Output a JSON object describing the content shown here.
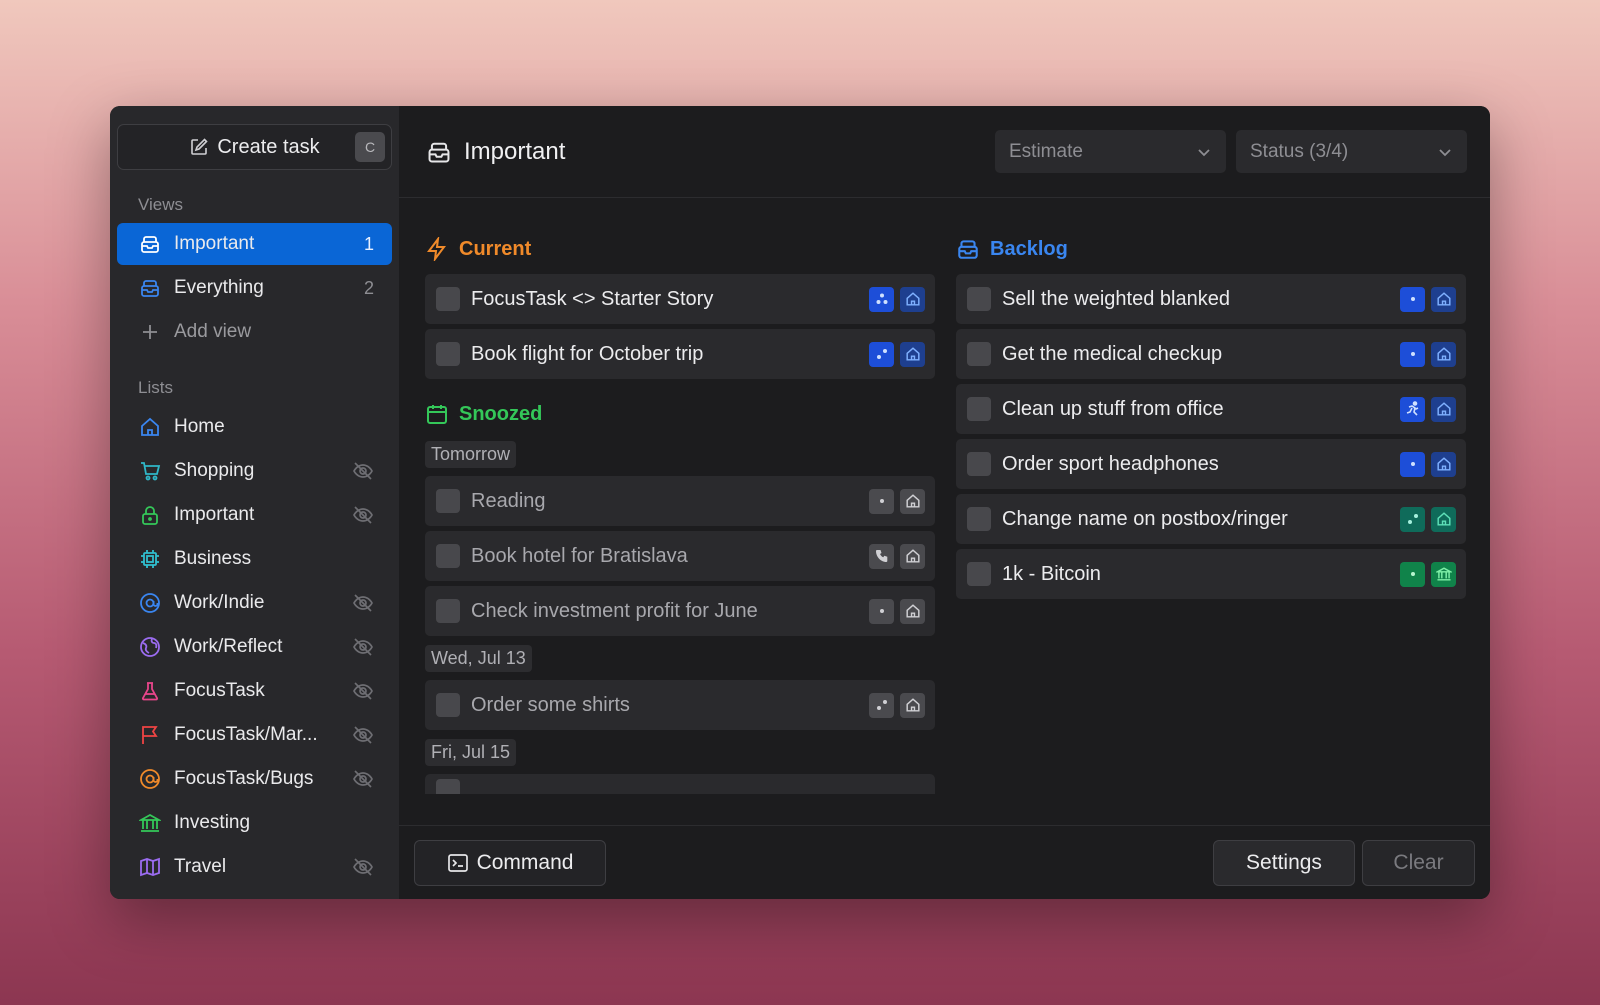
{
  "sidebar": {
    "create_label": "Create task",
    "create_shortcut": "C",
    "views_label": "Views",
    "views": [
      {
        "label": "Important",
        "count": "1",
        "active": true
      },
      {
        "label": "Everything",
        "count": "2"
      },
      {
        "label": "Add view"
      }
    ],
    "lists_label": "Lists",
    "lists": [
      {
        "label": "Home",
        "icon": "home-icon",
        "color": "#3a86f0",
        "hidden": false
      },
      {
        "label": "Shopping",
        "icon": "cart-icon",
        "color": "#2fb7c8",
        "hidden": true
      },
      {
        "label": "Important",
        "icon": "lock-icon",
        "color": "#34c759",
        "hidden": true
      },
      {
        "label": "Business",
        "icon": "chip-icon",
        "color": "#30c0d0",
        "hidden": false
      },
      {
        "label": "Work/Indie",
        "icon": "at-icon",
        "color": "#3a86f0",
        "hidden": true
      },
      {
        "label": "Work/Reflect",
        "icon": "globe-icon",
        "color": "#9b6cf0",
        "hidden": true
      },
      {
        "label": "FocusTask",
        "icon": "flask-icon",
        "color": "#e8458b",
        "hidden": true
      },
      {
        "label": "FocusTask/Mar...",
        "icon": "flag-icon",
        "color": "#ef4444",
        "hidden": true
      },
      {
        "label": "FocusTask/Bugs",
        "icon": "at-icon",
        "color": "#f08a2a",
        "hidden": true
      },
      {
        "label": "Investing",
        "icon": "bank-icon",
        "color": "#34c759",
        "hidden": false
      },
      {
        "label": "Travel",
        "icon": "map-icon",
        "color": "#9b6cf0",
        "hidden": true
      }
    ]
  },
  "header": {
    "title": "Important",
    "estimate_label": "Estimate",
    "status_label": "Status (3/4)"
  },
  "current": {
    "title": "Current",
    "tasks": [
      {
        "label": "FocusTask <> Starter Story"
      },
      {
        "label": "Book flight for October trip"
      }
    ]
  },
  "snoozed": {
    "title": "Snoozed",
    "groups": [
      {
        "date": "Tomorrow",
        "tasks": [
          {
            "label": "Reading"
          },
          {
            "label": "Book hotel for Bratislava"
          },
          {
            "label": "Check investment profit for June"
          }
        ]
      },
      {
        "date": "Wed, Jul 13",
        "tasks": [
          {
            "label": "Order some shirts"
          }
        ]
      },
      {
        "date": "Fri, Jul 15",
        "tasks": []
      }
    ]
  },
  "backlog": {
    "title": "Backlog",
    "tasks": [
      {
        "label": "Sell the weighted blanked"
      },
      {
        "label": "Get the medical checkup"
      },
      {
        "label": "Clean up stuff from office"
      },
      {
        "label": "Order sport headphones"
      },
      {
        "label": "Change name on postbox/ringer"
      },
      {
        "label": "1k - Bitcoin"
      }
    ]
  },
  "footer": {
    "command_label": "Command",
    "settings_label": "Settings",
    "clear_label": "Clear"
  }
}
